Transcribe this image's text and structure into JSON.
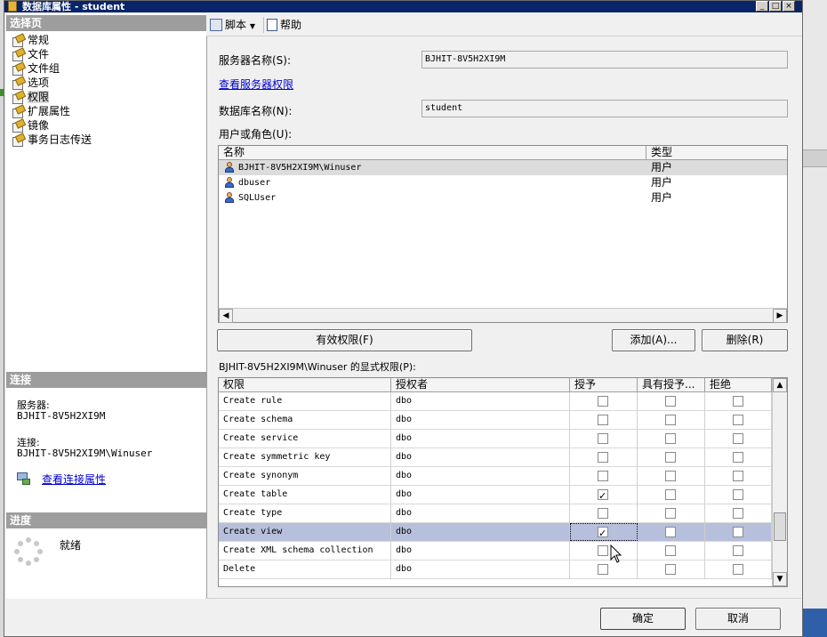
{
  "window": {
    "title": "数据库属性 - student"
  },
  "sidebar": {
    "select_page_header": "选择页",
    "pages": [
      {
        "label": "常规"
      },
      {
        "label": "文件"
      },
      {
        "label": "文件组"
      },
      {
        "label": "选项"
      },
      {
        "label": "权限"
      },
      {
        "label": "扩展属性"
      },
      {
        "label": "镜像"
      },
      {
        "label": "事务日志传送"
      }
    ],
    "selected_page": "权限",
    "connection_header": "连接",
    "server_label": "服务器:",
    "server_value": "BJHIT-8V5H2XI9M",
    "connection_label": "连接:",
    "connection_value": "BJHIT-8V5H2XI9M\\Winuser",
    "view_connection_link": "查看连接属性",
    "progress_header": "进度",
    "progress_status": "就绪"
  },
  "toolbar": {
    "script_label": "脚本",
    "help_label": "帮助"
  },
  "main": {
    "server_name_label": "服务器名称(S):",
    "server_name_value": "BJHIT-8V5H2XI9M",
    "view_server_permissions_link": "查看服务器权限",
    "database_name_label": "数据库名称(N):",
    "database_name_value": "student",
    "users_label": "用户或角色(U):",
    "users_columns": [
      "名称",
      "类型"
    ],
    "users": [
      {
        "name": "BJHIT-8V5H2XI9M\\Winuser",
        "type": "用户"
      },
      {
        "name": "dbuser",
        "type": "用户"
      },
      {
        "name": "SQLUser",
        "type": "用户"
      }
    ],
    "effective_permissions_button": "有效权限(F)",
    "add_button": "添加(A)...",
    "remove_button": "删除(R)",
    "explicit_permissions_label": "BJHIT-8V5H2XI9M\\Winuser 的显式权限(P):",
    "perm_columns": [
      "权限",
      "授权者",
      "授予",
      "具有授予...",
      "拒绝"
    ],
    "permissions": [
      {
        "permission": "Create rule",
        "grantor": "dbo",
        "grant": false,
        "with_grant": false,
        "deny": false
      },
      {
        "permission": "Create schema",
        "grantor": "dbo",
        "grant": false,
        "with_grant": false,
        "deny": false
      },
      {
        "permission": "Create service",
        "grantor": "dbo",
        "grant": false,
        "with_grant": false,
        "deny": false
      },
      {
        "permission": "Create symmetric key",
        "grantor": "dbo",
        "grant": false,
        "with_grant": false,
        "deny": false
      },
      {
        "permission": "Create synonym",
        "grantor": "dbo",
        "grant": false,
        "with_grant": false,
        "deny": false
      },
      {
        "permission": "Create table",
        "grantor": "dbo",
        "grant": true,
        "with_grant": false,
        "deny": false
      },
      {
        "permission": "Create type",
        "grantor": "dbo",
        "grant": false,
        "with_grant": false,
        "deny": false
      },
      {
        "permission": "Create view",
        "grantor": "dbo",
        "grant": true,
        "with_grant": false,
        "deny": false
      },
      {
        "permission": "Create XML schema collection",
        "grantor": "dbo",
        "grant": false,
        "with_grant": false,
        "deny": false
      },
      {
        "permission": "Delete",
        "grantor": "dbo",
        "grant": false,
        "with_grant": false,
        "deny": false
      }
    ],
    "selected_permission": "Create view"
  },
  "footer": {
    "ok_button": "确定",
    "cancel_button": "取消"
  }
}
